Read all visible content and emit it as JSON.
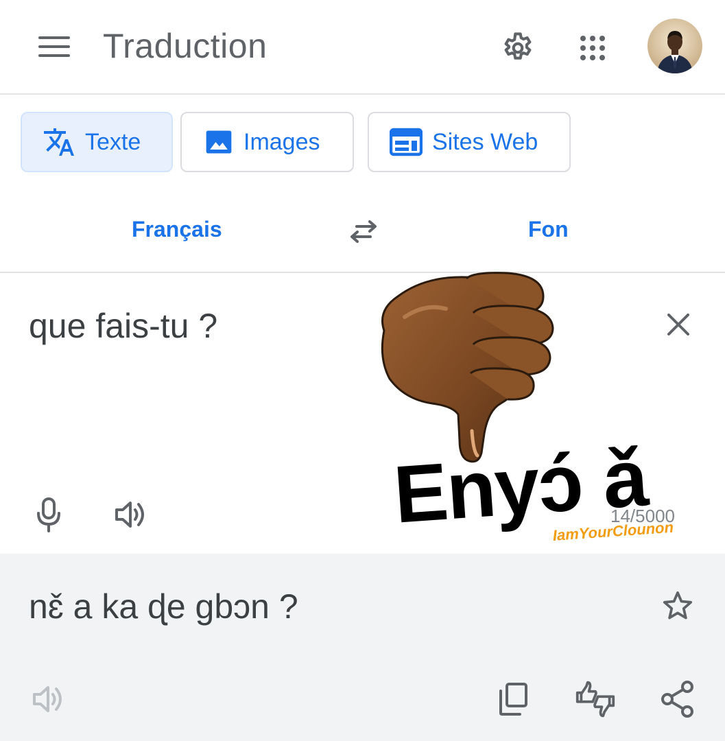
{
  "header": {
    "title": "Traduction",
    "icons": [
      "menu-icon",
      "settings-icon",
      "apps-grid-icon",
      "avatar"
    ]
  },
  "modes": [
    {
      "label": "Texte",
      "icon": "translate-icon",
      "active": true
    },
    {
      "label": "Images",
      "icon": "image-icon",
      "active": false
    },
    {
      "label": "Sites Web",
      "icon": "website-icon",
      "active": false
    }
  ],
  "languages": {
    "source": "Français",
    "target": "Fon"
  },
  "source": {
    "text": "que fais-tu ?",
    "char_count": "14/5000"
  },
  "sticker": {
    "word": "Enyɔ́ ǎ",
    "credit": "IamYourClounon"
  },
  "result": {
    "text": "nɛ̌ a ka ɖe gbɔn ?"
  },
  "colors": {
    "accent": "#1a73e8",
    "active_tab_bg": "#e8f0fe",
    "result_bg": "#f1f3f4",
    "icon_gray": "#5f6368"
  }
}
